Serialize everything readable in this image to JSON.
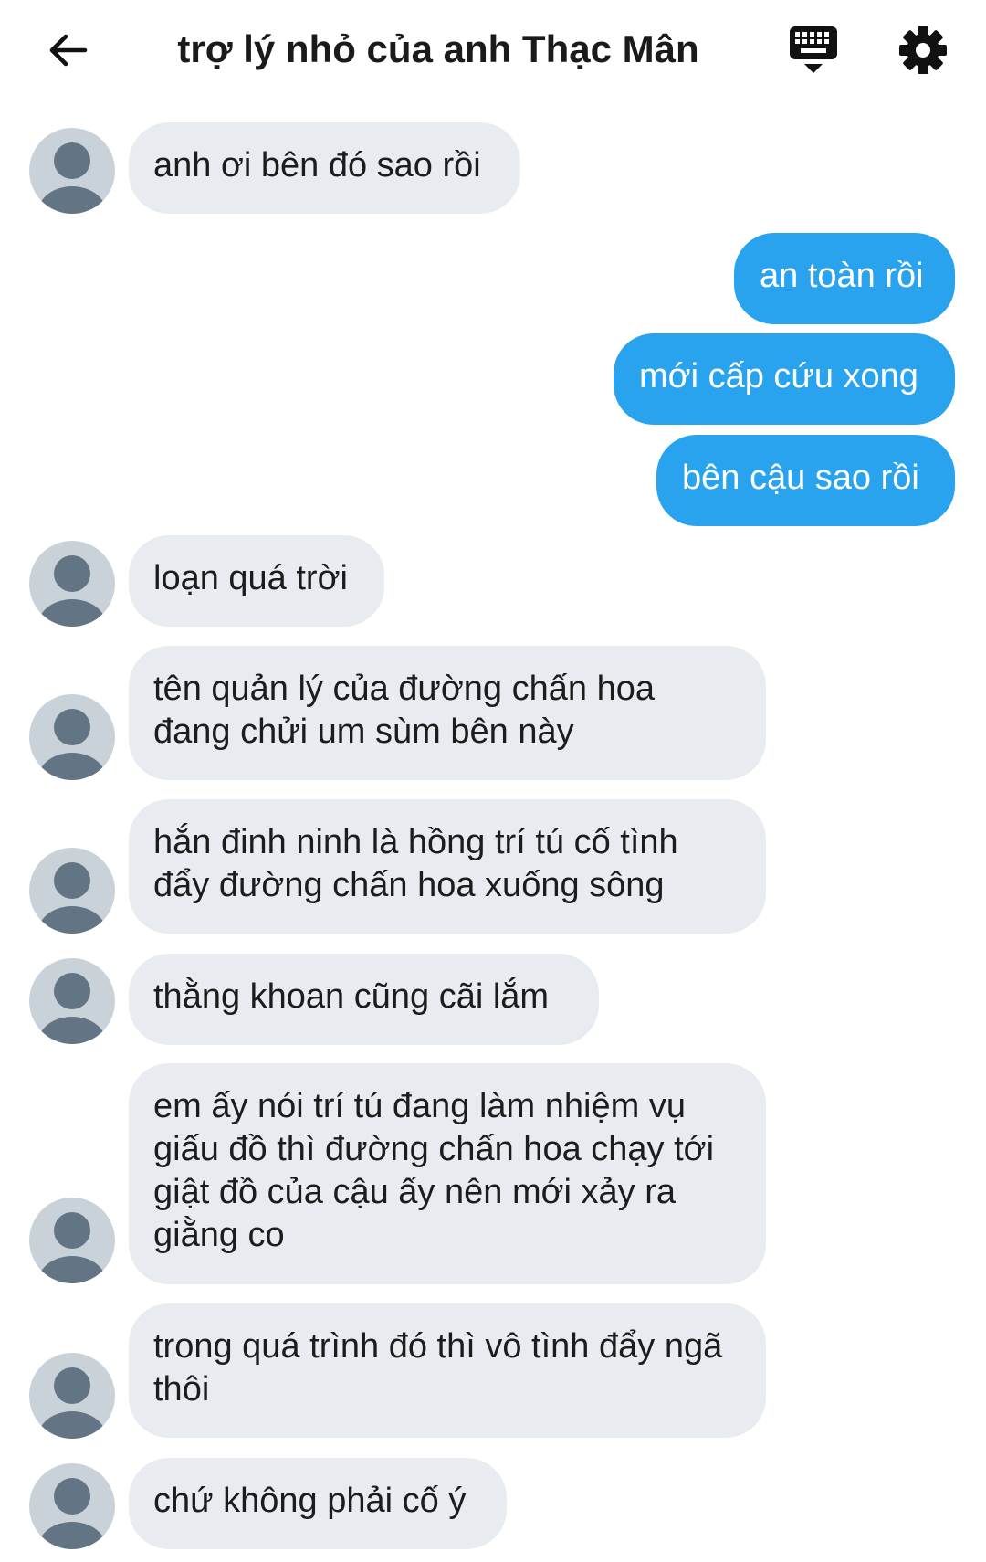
{
  "header": {
    "title": "trợ lý nhỏ của anh Thạc Mân",
    "icons": [
      "arrow-left-icon",
      "keyboard-icon",
      "gear-icon"
    ]
  },
  "colors": {
    "incoming_bubble": "#e8ecf0",
    "outgoing_bubble": "#2aa3ee",
    "avatar_bg": "#c9d2d9",
    "avatar_fg": "#637585"
  },
  "messages": [
    {
      "side": "in",
      "text": "anh ơi bên đó sao rồi"
    },
    {
      "side": "out",
      "text": "an toàn rồi"
    },
    {
      "side": "out",
      "text": "mới cấp cứu xong"
    },
    {
      "side": "out",
      "text": "bên cậu sao rồi"
    },
    {
      "side": "in",
      "text": "loạn quá trời"
    },
    {
      "side": "in",
      "text": "tên quản lý của đường chấn hoa đang chửi um sùm bên này"
    },
    {
      "side": "in",
      "text": "hắn đinh ninh là hồng trí tú cố tình đẩy đường chấn hoa xuống sông"
    },
    {
      "side": "in",
      "text": "thằng khoan cũng cãi lắm"
    },
    {
      "side": "in",
      "text": "em ấy nói trí tú đang làm nhiệm vụ giấu đồ thì đường chấn hoa chạy tới giật đồ của cậu ấy nên mới xảy ra giằng co"
    },
    {
      "side": "in",
      "text": "trong quá trình đó thì vô tình đẩy ngã thôi"
    },
    {
      "side": "in",
      "text": "chứ không phải cố ý"
    }
  ]
}
